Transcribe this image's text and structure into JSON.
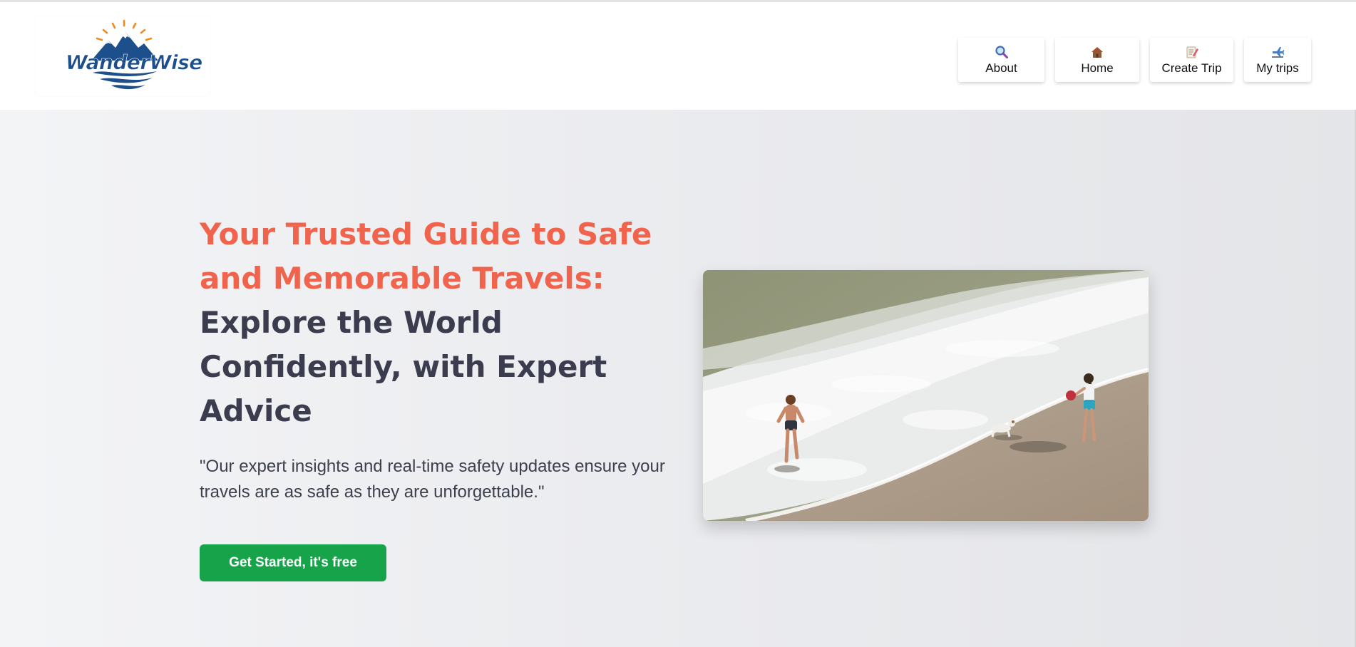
{
  "brand": {
    "logo_text": "WanderWise"
  },
  "nav": {
    "items": [
      {
        "label": "About",
        "icon": "magnifier-icon"
      },
      {
        "label": "Home",
        "icon": "house-icon"
      },
      {
        "label": "Create Trip",
        "icon": "memo-icon"
      },
      {
        "label": "My trips",
        "icon": "airplane-icon"
      }
    ]
  },
  "hero": {
    "headline_accent": "Your Trusted Guide to Safe and Memorable Travels:",
    "headline_rest": "Explore the World Confidently, with Expert Advice",
    "quote": "\"Our expert insights and real-time safety updates ensure your travels are as safe as they are unforgettable.\"",
    "cta_label": "Get Started, it's free",
    "image_alt": "Aerial view of a beach with two people and a dog at the waterline"
  },
  "colors": {
    "accent": "#f0634c",
    "headline": "#3b3d4e",
    "cta": "#16a349",
    "brand_blue": "#1d4f8c",
    "sun": "#f08a24"
  }
}
